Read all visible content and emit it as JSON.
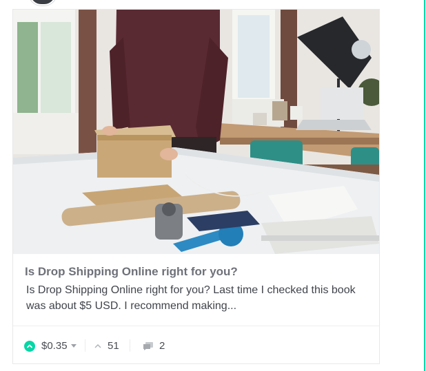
{
  "post": {
    "image_alt": "Person packing a cardboard box on a white table in a bright office",
    "title": "Is Drop Shipping Online right for you?",
    "excerpt": "Is Drop Shipping Online right for you? Last time I checked this book was about $5 USD. I recommend making..."
  },
  "footer": {
    "payout": "$0.35",
    "votes": "51",
    "comments": "2"
  },
  "icons": {
    "upvote": "upvote-circle-icon",
    "payout_dropdown": "chevron-down-icon",
    "votes": "chevron-up-icon",
    "comments": "comments-icon"
  },
  "colors": {
    "accent": "#07d6a6",
    "title": "#6e7179",
    "text": "#40444b"
  }
}
